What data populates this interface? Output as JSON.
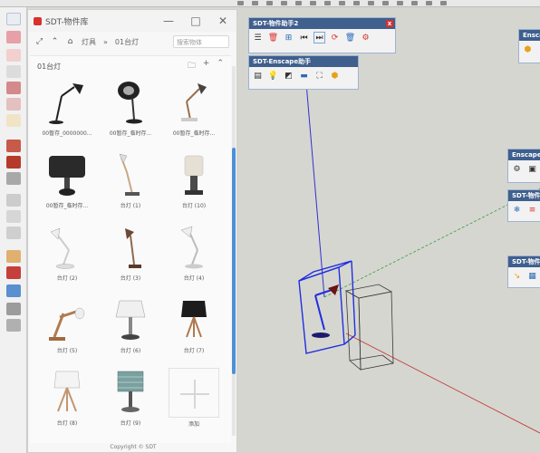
{
  "library": {
    "title": "SDT-物件库",
    "win_min": "—",
    "win_max": "□",
    "win_close": "✕",
    "breadcrumb_root": "灯具",
    "breadcrumb_sep": "»",
    "breadcrumb_current": "01台灯",
    "search_placeholder": "搜索物体",
    "folder": "01台灯",
    "folder_icon_new": "🗀",
    "folder_icon_add": "+",
    "folder_icon_collapse": "⌃",
    "items": [
      {
        "label": "00暂存_0000000..."
      },
      {
        "label": "00暂存_临时存..."
      },
      {
        "label": "00暂存_临时存..."
      },
      {
        "label": "00暂存_临时存..."
      },
      {
        "label": "台灯 (1)"
      },
      {
        "label": "台灯 (10)"
      },
      {
        "label": "台灯 (2)"
      },
      {
        "label": "台灯 (3)"
      },
      {
        "label": "台灯 (4)"
      },
      {
        "label": "台灯 (5)"
      },
      {
        "label": "台灯 (6)"
      },
      {
        "label": "台灯 (7)"
      },
      {
        "label": "台灯 (8)"
      },
      {
        "label": "台灯 (9)"
      },
      {
        "label": "添加"
      }
    ],
    "copyright": "Copyright © SDT"
  },
  "toolbars": {
    "helper2": {
      "title": "SDT-物件助手2",
      "close": "x"
    },
    "enscape_helper": {
      "title": "SDT-Enscape助手"
    },
    "enscape": {
      "title": "Enscape"
    },
    "enscape2": {
      "title": "Enscape"
    },
    "sdt_more": {
      "title": "SDT-物件"
    },
    "sdt_more2": {
      "title": "SDT-物件"
    }
  },
  "colors": {
    "toolbar_title_bg": "#3f5f8d",
    "close_red": "#d9302c",
    "selection_blue": "#1f2fe0",
    "scroll_blue": "#4e8fd8",
    "axis_red": "#c03030",
    "axis_green": "#3aa040",
    "axis_blue": "#3030d0"
  }
}
